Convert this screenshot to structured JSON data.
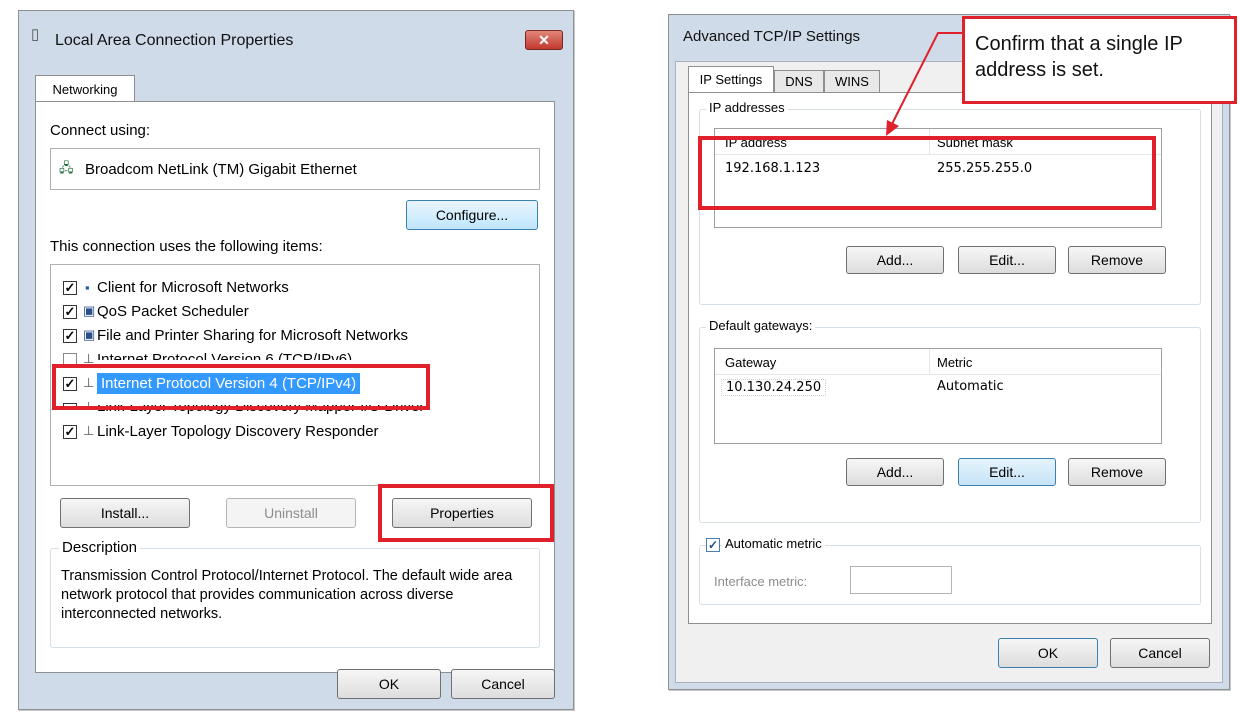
{
  "left": {
    "title": "Local Area Connection Properties",
    "tab": "Networking",
    "connect_using_label": "Connect using:",
    "adapter_name": "Broadcom NetLink (TM) Gigabit Ethernet",
    "configure_button": "Configure...",
    "items_label": "This connection uses the following items:",
    "items": [
      {
        "label": "Client for Microsoft Networks",
        "checked": true
      },
      {
        "label": "QoS Packet Scheduler",
        "checked": true
      },
      {
        "label": "File and Printer Sharing for Microsoft Networks",
        "checked": true
      },
      {
        "label": "Internet Protocol Version 6 (TCP/IPv6)",
        "checked": false
      },
      {
        "label": "Internet Protocol Version 4 (TCP/IPv4)",
        "checked": true
      },
      {
        "label": "Link-Layer Topology Discovery Mapper I/O Driver",
        "checked": true
      },
      {
        "label": "Link-Layer Topology Discovery Responder",
        "checked": true
      }
    ],
    "install_button": "Install...",
    "uninstall_button": "Uninstall",
    "properties_button": "Properties",
    "description_label": "Description",
    "description_text": "Transmission Control Protocol/Internet Protocol. The default wide area network protocol that provides communication across diverse interconnected networks.",
    "ok_button": "OK",
    "cancel_button": "Cancel"
  },
  "right": {
    "title": "Advanced TCP/IP Settings",
    "tabs": [
      "IP Settings",
      "DNS",
      "WINS"
    ],
    "ip_group_label": "IP addresses",
    "ip_columns": [
      "IP address",
      "Subnet mask"
    ],
    "ip_rows": [
      [
        "192.168.1.123",
        "255.255.255.0"
      ]
    ],
    "ip_add": "Add...",
    "ip_edit": "Edit...",
    "ip_remove": "Remove",
    "gw_group_label": "Default gateways:",
    "gw_columns": [
      "Gateway",
      "Metric"
    ],
    "gw_rows": [
      [
        "10.130.24.250",
        "Automatic"
      ]
    ],
    "gw_add": "Add...",
    "gw_edit": "Edit...",
    "gw_remove": "Remove",
    "auto_metric_label": "Automatic metric",
    "auto_metric_checked": true,
    "interface_metric_label": "Interface metric:",
    "interface_metric_value": "",
    "ok_button": "OK",
    "cancel_button": "Cancel"
  },
  "callout": {
    "text": "Confirm that a single IP address is set."
  },
  "colors": {
    "highlight": "#e0202a",
    "selection": "#3399ff",
    "title_bar": "#cfdbe9",
    "close_button": "#c9463d"
  }
}
